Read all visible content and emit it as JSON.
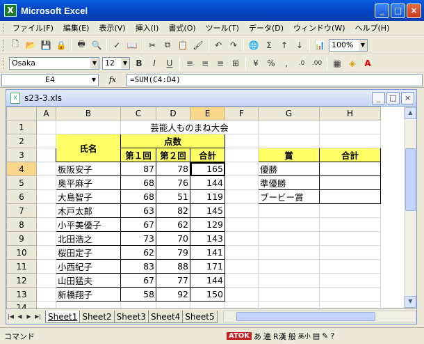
{
  "window": {
    "title": "Microsoft Excel",
    "minimize": "_",
    "maximize": "□",
    "close": "×"
  },
  "menu": [
    "ファイル(F)",
    "編集(E)",
    "表示(V)",
    "挿入(I)",
    "書式(O)",
    "ツール(T)",
    "データ(D)",
    "ウィンドウ(W)",
    "ヘルプ(H)"
  ],
  "toolbar": {
    "zoom": "100%",
    "font": "Osaka",
    "size": "12",
    "bold": "B",
    "italic": "I",
    "underline": "U",
    "percent": "%",
    "comma": ","
  },
  "formula_bar": {
    "cell": "E4",
    "fx": "fx",
    "formula": "=SUM(C4:D4)"
  },
  "workbook": {
    "filename": "s23-3.xls"
  },
  "grid": {
    "col_headers": [
      "",
      "A",
      "B",
      "C",
      "D",
      "E",
      "F",
      "G",
      "H"
    ],
    "row_headers": [
      "1",
      "2",
      "3",
      "4",
      "5",
      "6",
      "7",
      "8",
      "9",
      "10",
      "11",
      "12",
      "13",
      "14"
    ],
    "title": "芸能人ものまね大会",
    "name_header": "氏名",
    "score_header": "点数",
    "round1": "第１回",
    "round2": "第２回",
    "total": "合計",
    "prize_header": "賞",
    "prize_total": "合計",
    "prizes": [
      "優勝",
      "準優勝",
      "ブービー賞"
    ],
    "rows": [
      {
        "name": "板阪安子",
        "c": "87",
        "d": "78",
        "e": "165"
      },
      {
        "name": "奥平麻子",
        "c": "68",
        "d": "76",
        "e": "144"
      },
      {
        "name": "大島智子",
        "c": "68",
        "d": "51",
        "e": "119"
      },
      {
        "name": "木戸太郎",
        "c": "63",
        "d": "82",
        "e": "145"
      },
      {
        "name": "小平美優子",
        "c": "67",
        "d": "62",
        "e": "129"
      },
      {
        "name": "北田浩之",
        "c": "73",
        "d": "70",
        "e": "143"
      },
      {
        "name": "桜田定子",
        "c": "62",
        "d": "79",
        "e": "141"
      },
      {
        "name": "小西紀子",
        "c": "83",
        "d": "88",
        "e": "171"
      },
      {
        "name": "山田猛夫",
        "c": "67",
        "d": "77",
        "e": "144"
      },
      {
        "name": "新橋翔子",
        "c": "58",
        "d": "92",
        "e": "150"
      }
    ]
  },
  "sheets": [
    "Sheet1",
    "Sheet2",
    "Sheet3",
    "Sheet4",
    "Sheet5"
  ],
  "status": {
    "mode": "コマンド",
    "ime": [
      "ATOK",
      "あ",
      "連",
      "R漢",
      "般",
      "英小"
    ]
  }
}
